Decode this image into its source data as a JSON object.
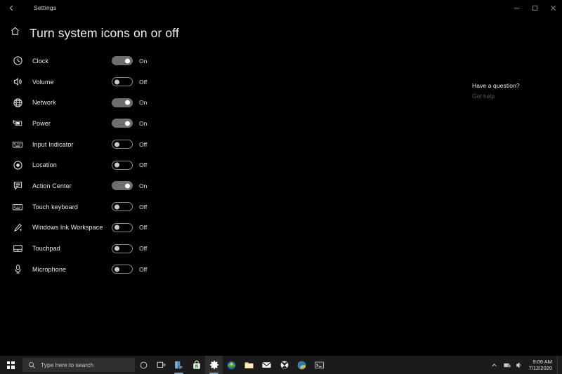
{
  "window": {
    "app_title": "Settings",
    "back_icon": "back-arrow-icon",
    "minimize_label": "Minimize",
    "maximize_label": "Maximize",
    "close_label": "Close"
  },
  "header": {
    "home_icon": "home-icon",
    "title": "Turn system icons on or off"
  },
  "system_icons": [
    {
      "icon": "clock-icon",
      "label": "Clock",
      "state": "On",
      "on": true
    },
    {
      "icon": "volume-icon",
      "label": "Volume",
      "state": "Off",
      "on": false
    },
    {
      "icon": "network-icon",
      "label": "Network",
      "state": "On",
      "on": true
    },
    {
      "icon": "power-icon",
      "label": "Power",
      "state": "On",
      "on": true
    },
    {
      "icon": "keyboard-icon",
      "label": "Input Indicator",
      "state": "Off",
      "on": false
    },
    {
      "icon": "location-icon",
      "label": "Location",
      "state": "Off",
      "on": false
    },
    {
      "icon": "action-center-icon",
      "label": "Action Center",
      "state": "On",
      "on": true
    },
    {
      "icon": "touch-keyboard-icon",
      "label": "Touch keyboard",
      "state": "Off",
      "on": false
    },
    {
      "icon": "pen-icon",
      "label": "Windows Ink Workspace",
      "state": "Off",
      "on": false
    },
    {
      "icon": "touchpad-icon",
      "label": "Touchpad",
      "state": "Off",
      "on": false
    },
    {
      "icon": "microphone-icon",
      "label": "Microphone",
      "state": "Off",
      "on": false
    }
  ],
  "help": {
    "title": "Have a question?",
    "link": "Get help"
  },
  "taskbar": {
    "start_label": "Start",
    "search_placeholder": "Type here to search",
    "search_icon": "search-icon",
    "cortana_label": "Cortana",
    "taskview_label": "Task View",
    "apps": [
      {
        "name": "file-explorer-blue-icon",
        "label": "Explorer"
      },
      {
        "name": "microsoft-store-icon",
        "label": "Microsoft Store"
      },
      {
        "name": "settings-gear-icon",
        "label": "Settings"
      },
      {
        "name": "firefox-icon",
        "label": "Firefox"
      },
      {
        "name": "file-explorer-icon",
        "label": "File Explorer"
      },
      {
        "name": "mail-icon",
        "label": "Mail"
      },
      {
        "name": "xbox-icon",
        "label": "Xbox"
      },
      {
        "name": "edge-icon",
        "label": "Microsoft Edge"
      },
      {
        "name": "terminal-icon",
        "label": "Command Prompt"
      }
    ],
    "tray": {
      "chevron_label": "Show hidden icons",
      "network_label": "Network",
      "volume_label": "Volume",
      "time": "9:06 AM",
      "date": "7/12/2020"
    }
  },
  "colors": {
    "background": "#000000",
    "toggle_on": "#6e6e6e",
    "taskbar": "#1b1b1b",
    "link": "#585858"
  }
}
